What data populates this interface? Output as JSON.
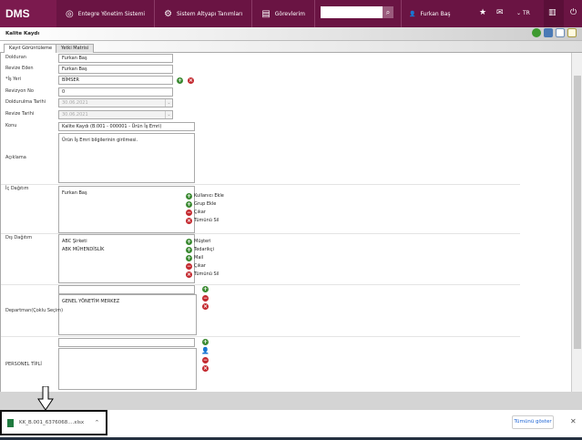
{
  "nav": {
    "logo": "DMS",
    "items": [
      "Entegre Yönetim Sistemi",
      "Sistem Altyapı Tanımları",
      "Görevlerim"
    ],
    "user": "Furkan Baş",
    "lang": "TR"
  },
  "page": {
    "title": "Kalite Kaydı",
    "tabs": [
      "Kayıt Görüntüleme",
      "Yetki Matrisi"
    ]
  },
  "form": {
    "dolduran": {
      "label": "Dolduran",
      "value": "Furkan Baş"
    },
    "revize_eden": {
      "label": "Revize Eden",
      "value": "Furkan Baş"
    },
    "is_yeri": {
      "label": "*İş Yeri",
      "value": "BİMSER"
    },
    "revizyon_no": {
      "label": "Revizyon No",
      "value": "0"
    },
    "doldurulma_tarihi": {
      "label": "Doldurulma Tarihi",
      "value": "30.06.2021"
    },
    "revize_tarihi": {
      "label": "Revize Tarihi",
      "value": "30.06.2021"
    },
    "konu": {
      "label": "Konu",
      "value": "Kalite Kaydı (B.001 - 000001 - Ürün İş Emri)"
    },
    "aciklama": {
      "label": "Açıklama",
      "value": "Ürün İş Emri bilgilerinin girilmesi."
    },
    "ic_dagitim": {
      "label": "İç Dağıtım",
      "items": [
        "Furkan Baş"
      ],
      "actions": [
        "Kullanıcı Ekle",
        "Grup Ekle",
        "Çıkar",
        "Tümünü Sil"
      ]
    },
    "dis_dagitim": {
      "label": "Dış Dağıtım",
      "items": [
        "ABC Şirketi",
        "ABK MÜHENDİSLİK"
      ],
      "actions": [
        "Müşteri",
        "Tedarikçi",
        "Mail",
        "Çıkar",
        "Tümünü Sil"
      ]
    },
    "departman": {
      "label": "Departman(Çoklu Seçim)",
      "items": [
        "GENEL YÖNETİM MERKEZ"
      ]
    },
    "personel": {
      "label": "PERSONEL TİPLİ"
    }
  },
  "download": {
    "file": "KK_B.001_6376068....xlsx",
    "show_all": "Tümünü göster"
  }
}
